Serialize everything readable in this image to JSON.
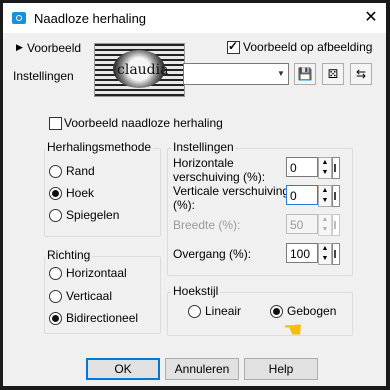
{
  "window": {
    "title": "Naadloze herhaling",
    "close_glyph": "✕"
  },
  "top": {
    "preview_toggle": "Voorbeeld",
    "preview_on_image": "Voorbeeld op afbeelding",
    "settings_label": "Instellingen",
    "preview_logo_text": "claudia"
  },
  "seamless_preview_label": "Voorbeeld naadloze herhaling",
  "repeat_method": {
    "title": "Herhalingsmethode",
    "options": [
      "Rand",
      "Hoek",
      "Spiegelen"
    ],
    "selected": "Hoek"
  },
  "direction": {
    "title": "Richting",
    "options": [
      "Horizontaal",
      "Verticaal",
      "Bidirectioneel"
    ],
    "selected": "Bidirectioneel"
  },
  "settings": {
    "title": "Instellingen",
    "h_offset_label": "Horizontale verschuiving (%):",
    "h_offset_value": "0",
    "v_offset_label": "Verticale verschuiving (%):",
    "v_offset_value": "0",
    "width_label": "Breedte (%):",
    "width_value": "50",
    "transition_label": "Overgang (%):",
    "transition_value": "100"
  },
  "corner_style": {
    "title": "Hoekstijl",
    "options": [
      "Lineair",
      "Gebogen"
    ],
    "selected": "Gebogen"
  },
  "buttons": {
    "ok": "OK",
    "cancel": "Annuleren",
    "help": "Help"
  }
}
